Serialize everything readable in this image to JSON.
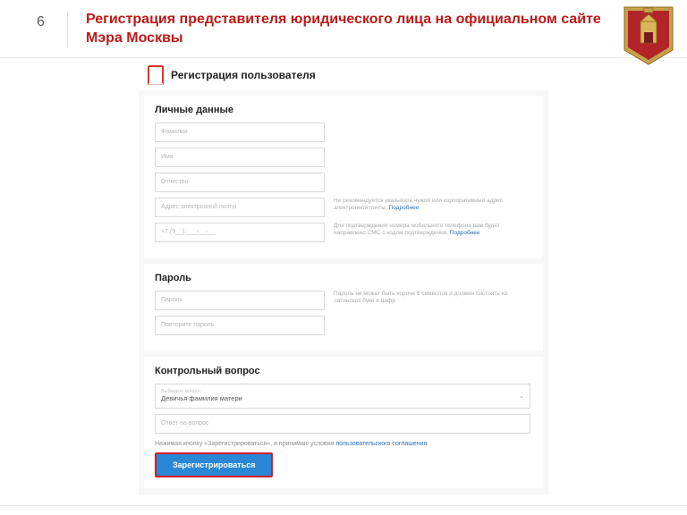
{
  "header": {
    "page_number": "6",
    "title": "Регистрация представителя юридического лица на официальном сайте Мэра Москвы"
  },
  "form": {
    "page_title": "Регистрация пользователя",
    "section_personal": {
      "heading": "Личные данные",
      "surname": "Фамилия",
      "name": "Имя",
      "patronymic": "Отчество",
      "email": "Адрес электронной почты",
      "email_hint": "Не рекомендуется указывать чужой или корпоративный адрес электронной почты.",
      "email_hint_link": "Подробнее",
      "phone": "+7 (9__) ___-__-__",
      "phone_hint": "Для подтверждения номера мобильного телефона вам будет направлено СМС с кодом подтверждения.",
      "phone_hint_link": "Подробнее"
    },
    "section_password": {
      "heading": "Пароль",
      "password": "Пароль",
      "password_hint": "Пароль не может быть короче 6 символов и должен состоять из латинских букв и цифр",
      "password_repeat": "Повторите пароль"
    },
    "section_question": {
      "heading": "Контрольный вопрос",
      "select_label": "Выберите вопрос",
      "select_value": "Девичья фамилия матери",
      "answer": "Ответ на вопрос"
    },
    "consent_prefix": "Нажимая кнопку «Зарегистрироваться», я принимаю условия ",
    "consent_link": "пользовательского соглашения",
    "submit": "Зарегистрироваться"
  }
}
